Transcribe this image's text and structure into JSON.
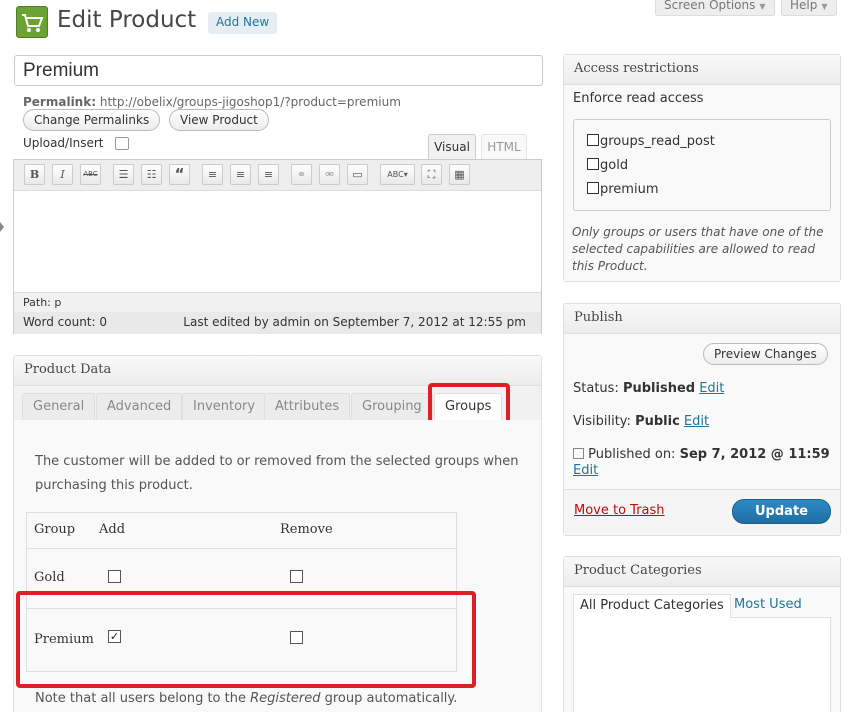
{
  "header": {
    "title": "Edit Product",
    "add_new": "Add New",
    "screen_options": "Screen Options",
    "help": "Help"
  },
  "post": {
    "title_value": "Premium",
    "permalink_label": "Permalink:",
    "permalink_url": "http://obelix/groups-jigoshop1/?product=premium",
    "change_permalinks": "Change Permalinks",
    "view_product": "View Product"
  },
  "editor": {
    "upload_insert": "Upload/Insert",
    "tab_visual": "Visual",
    "tab_html": "HTML",
    "toolbar": [
      "bold-icon",
      "italic-icon",
      "strikethrough-icon",
      "bullet-list-icon",
      "numbered-list-icon",
      "blockquote-icon",
      "align-left-icon",
      "align-center-icon",
      "align-right-icon",
      "link-icon",
      "unlink-icon",
      "insert-more-icon",
      "spellcheck-icon",
      "fullscreen-icon",
      "kitchen-sink-icon"
    ],
    "path_label": "Path:",
    "path_value": "p",
    "word_count": "Word count: 0",
    "last_edited": "Last edited by admin on September 7, 2012 at 12:55 pm"
  },
  "product_data": {
    "title": "Product Data",
    "tabs": [
      "General",
      "Advanced",
      "Inventory",
      "Attributes",
      "Grouping",
      "Groups"
    ],
    "active_tab": "Groups",
    "description": "The customer will be added to or removed from the selected groups when purchasing this product.",
    "columns": [
      "Group",
      "Add",
      "Remove"
    ],
    "rows": [
      {
        "name": "Gold",
        "add": false,
        "remove": false
      },
      {
        "name": "Premium",
        "add": true,
        "remove": false
      }
    ],
    "note_before": "Note that all users belong to the ",
    "note_em": "Registered",
    "note_after": " group automatically."
  },
  "access": {
    "title": "Access restrictions",
    "enforce_label": "Enforce read access",
    "capabilities": [
      "groups_read_post",
      "gold",
      "premium"
    ],
    "note": "Only groups or users that have one of the selected capabilities are allowed to read this Product."
  },
  "publish": {
    "title": "Publish",
    "preview": "Preview Changes",
    "status_label": "Status:",
    "status_value": "Published",
    "visibility_label": "Visibility:",
    "visibility_value": "Public",
    "edit": "Edit",
    "published_on_label": "Published on:",
    "published_on_value": "Sep 7, 2012 @ 11:59",
    "move_to_trash": "Move to Trash",
    "update": "Update"
  },
  "categories": {
    "title": "Product Categories",
    "tab_all": "All Product Categories",
    "tab_most_used": "Most Used"
  },
  "colors": {
    "highlight": "#dd1f26",
    "link": "#21759b",
    "primary_button": "#2481bd"
  }
}
